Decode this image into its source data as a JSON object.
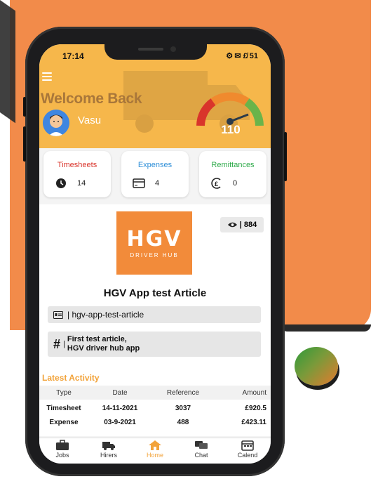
{
  "status_bar": {
    "time": "17:14",
    "indicators": "⚙ ✉ £̸ 51"
  },
  "header": {
    "welcome": "Welcome Back",
    "username": "Vasu",
    "score": "110",
    "gauge_level": 0.75,
    "colors": {
      "header_bg": "#f6b74b",
      "gauge_red": "#d9342b",
      "gauge_orange": "#f08a2e",
      "gauge_green": "#6ab44a"
    }
  },
  "stat_cards": [
    {
      "title": "Timesheets",
      "value": "14",
      "icon": "clock-icon",
      "color": "#d9342b"
    },
    {
      "title": "Expenses",
      "value": "4",
      "icon": "card-icon",
      "color": "#2f8fd8"
    },
    {
      "title": "Remittances",
      "value": "0",
      "icon": "pound-icon",
      "color": "#2eaa4a"
    }
  ],
  "article": {
    "logo_text": "HGV",
    "logo_subtext": "DRIVER HUB",
    "views": "| 884",
    "title": "HGV App test Article",
    "slug": "| hgv-app-test-article",
    "description_line1": "First test article,",
    "description_line2": "HGV driver hub app"
  },
  "activity": {
    "title": "Latest Activity",
    "columns": [
      "Type",
      "Date",
      "Reference",
      "Amount"
    ],
    "rows": [
      [
        "Timesheet",
        "14-11-2021",
        "3037",
        "£920.5"
      ],
      [
        "Expense",
        "03-9-2021",
        "488",
        "£423.11"
      ]
    ]
  },
  "tabs": [
    {
      "label": "Jobs",
      "icon": "briefcase-icon"
    },
    {
      "label": "Hirers",
      "icon": "truck-icon"
    },
    {
      "label": "Home",
      "icon": "home-icon",
      "active": true
    },
    {
      "label": "Chat",
      "icon": "chat-icon"
    },
    {
      "label": "Calend",
      "icon": "calendar-icon"
    }
  ]
}
